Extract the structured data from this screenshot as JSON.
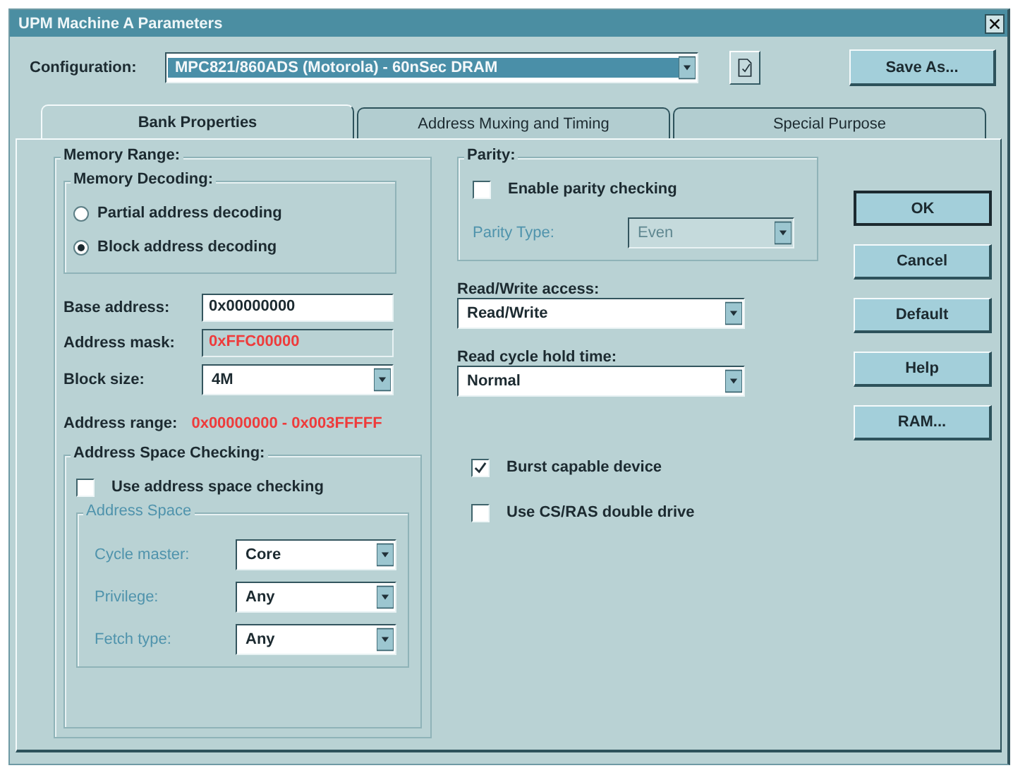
{
  "window": {
    "title": "UPM Machine A Parameters"
  },
  "configuration": {
    "label": "Configuration:",
    "value": "MPC821/860ADS (Motorola) - 60nSec DRAM",
    "save_button": "Save As..."
  },
  "tabs": [
    {
      "label": "Bank Properties",
      "selected": true
    },
    {
      "label": "Address Muxing and Timing",
      "selected": false
    },
    {
      "label": "Special Purpose",
      "selected": false
    }
  ],
  "memory_range": {
    "title": "Memory Range:",
    "decoding": {
      "title": "Memory Decoding:",
      "options": [
        {
          "label": "Partial address decoding",
          "selected": false
        },
        {
          "label": "Block address decoding",
          "selected": true
        }
      ]
    },
    "fields": [
      {
        "kind": "text",
        "label": "Base address:",
        "value": "0x00000000"
      },
      {
        "kind": "readonly",
        "label": "Address mask:",
        "value": "0xFFC00000"
      },
      {
        "kind": "dropdown",
        "label": "Block size:",
        "value": "4M"
      }
    ],
    "address_range": {
      "label": "Address range:",
      "value": "0x00000000 - 0x003FFFFF"
    },
    "space_checking": {
      "title": "Address Space Checking:",
      "checkbox": {
        "label": "Use address space checking",
        "checked": false
      },
      "address_space": {
        "title": "Address Space",
        "disabled": true,
        "fields": [
          {
            "label": "Cycle master:",
            "value": "Core"
          },
          {
            "label": "Privilege:",
            "value": "Any"
          },
          {
            "label": "Fetch type:",
            "value": "Any"
          }
        ]
      }
    }
  },
  "parity": {
    "title": "Parity:",
    "checkbox": {
      "label": "Enable parity checking",
      "checked": false
    },
    "type": {
      "label": "Parity Type:",
      "value": "Even",
      "disabled": true
    }
  },
  "dropdowns": [
    {
      "label": "Read/Write access:",
      "value": "Read/Write"
    },
    {
      "label": "Read cycle hold time:",
      "value": "Normal"
    }
  ],
  "options": [
    {
      "label": "Burst capable device",
      "checked": true
    },
    {
      "label": "Use CS/RAS double drive",
      "checked": false
    }
  ],
  "buttons": [
    {
      "label": "OK",
      "default": true
    },
    {
      "label": "Cancel",
      "default": false
    },
    {
      "label": "Default",
      "default": false
    },
    {
      "label": "Help",
      "default": false
    },
    {
      "label": "RAM...",
      "default": false
    }
  ]
}
